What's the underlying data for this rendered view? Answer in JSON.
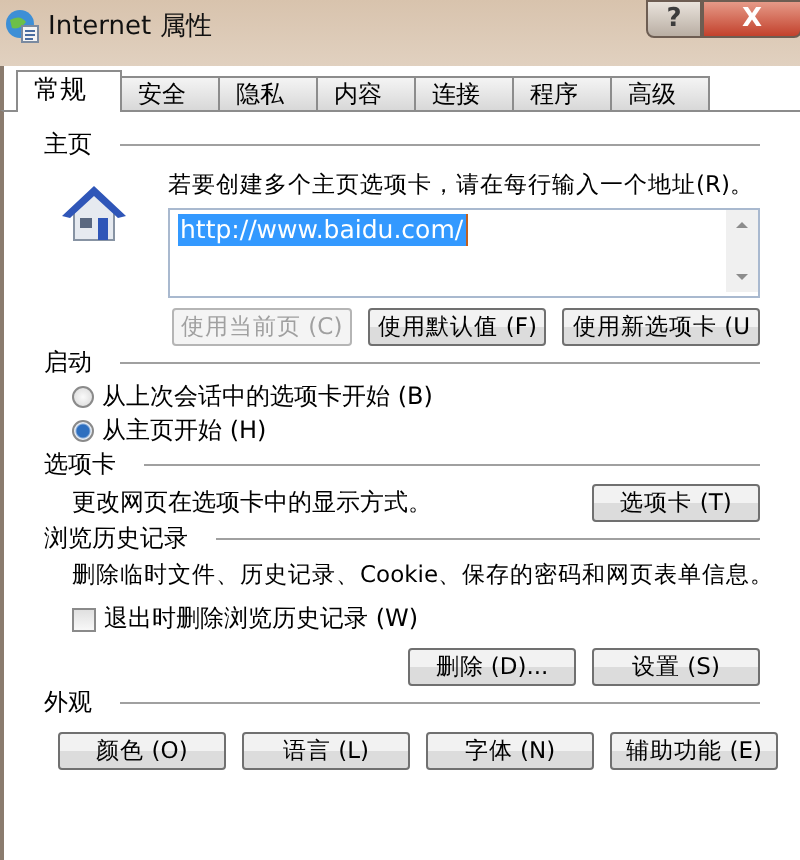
{
  "window": {
    "title": "Internet 属性",
    "help": "?",
    "close": "X"
  },
  "tabs": [
    {
      "label": "常规",
      "selected": true
    },
    {
      "label": "安全",
      "selected": false
    },
    {
      "label": "隐私",
      "selected": false
    },
    {
      "label": "内容",
      "selected": false
    },
    {
      "label": "连接",
      "selected": false
    },
    {
      "label": "程序",
      "selected": false
    },
    {
      "label": "高级",
      "selected": false
    }
  ],
  "homepage": {
    "heading": "主页",
    "instruction": "若要创建多个主页选项卡，请在每行输入一个地址(R)。",
    "value": "http://www.baidu.com/",
    "text_selected": true,
    "buttons": [
      {
        "label": "使用当前页 (C)",
        "disabled": true
      },
      {
        "label": "使用默认值 (F)",
        "disabled": false
      },
      {
        "label": "使用新选项卡 (U",
        "disabled": false
      }
    ]
  },
  "startup": {
    "heading": "启动",
    "options": [
      {
        "label": "从上次会话中的选项卡开始 (B)",
        "selected": false
      },
      {
        "label": "从主页开始 (H)",
        "selected": true
      }
    ]
  },
  "tab_settings": {
    "heading": "选项卡",
    "description": "更改网页在选项卡中的显示方式。",
    "button": "选项卡 (T)"
  },
  "history": {
    "heading": "浏览历史记录",
    "description": "删除临时文件、历史记录、Cookie、保存的密码和网页表单信息。",
    "checkbox": {
      "label": "退出时删除浏览历史记录 (W)",
      "checked": false
    },
    "buttons": [
      "删除 (D)...",
      "设置 (S)"
    ]
  },
  "appearance": {
    "heading": "外观",
    "buttons": [
      "颜色 (O)",
      "语言 (L)",
      "字体 (N)",
      "辅助功能 (E)"
    ]
  }
}
